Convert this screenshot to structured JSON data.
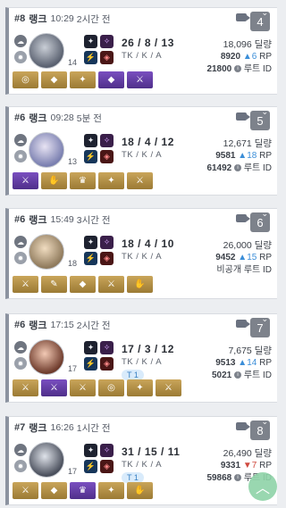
{
  "labels": {
    "mode": "랭크",
    "kda": "TK / K / A",
    "damage_unit": "딜량",
    "rp_unit": "RP",
    "route_id": "루트 ID"
  },
  "matches": [
    {
      "place": "#8",
      "time": "10:29",
      "ago": "2시간 전",
      "badge": "4",
      "level": "14",
      "kda": "26 / 8 / 13",
      "tag": "",
      "damage": "18,096",
      "rp": "8920",
      "rp_change": "6",
      "rp_dir": "up",
      "route": "21800",
      "items": [
        "◎",
        "◆",
        "✦",
        "◆",
        "⚔"
      ]
    },
    {
      "place": "#6",
      "time": "09:28",
      "ago": "5분 전",
      "badge": "5",
      "level": "13",
      "kda": "18 / 4 / 12",
      "tag": "",
      "damage": "12,671",
      "rp": "9581",
      "rp_change": "18",
      "rp_dir": "up",
      "route": "61492",
      "items": [
        "⚔",
        "✋",
        "♛",
        "✦",
        "⚔"
      ]
    },
    {
      "place": "#6",
      "time": "15:49",
      "ago": "3시간 전",
      "badge": "6",
      "level": "18",
      "kda": "18 / 4 / 10",
      "tag": "",
      "damage": "26,000",
      "rp": "9452",
      "rp_change": "15",
      "rp_dir": "up",
      "route": "비공개",
      "items": [
        "⚔",
        "✎",
        "◆",
        "⚔",
        "✋"
      ]
    },
    {
      "place": "#6",
      "time": "17:15",
      "ago": "2시간 전",
      "badge": "7",
      "level": "17",
      "kda": "17 / 3 / 12",
      "tag": "T 1",
      "damage": "7,675",
      "rp": "9513",
      "rp_change": "14",
      "rp_dir": "up",
      "route": "5021",
      "items": [
        "⚔",
        "⚔",
        "⚔",
        "◎",
        "✦",
        "⚔"
      ]
    },
    {
      "place": "#7",
      "time": "16:26",
      "ago": "1시간 전",
      "badge": "8",
      "level": "17",
      "kda": "31 / 15 / 11",
      "tag": "T 1",
      "damage": "26,490",
      "rp": "9331",
      "rp_change": "7",
      "rp_dir": "down",
      "route": "59868",
      "items": [
        "⚔",
        "◆",
        "♛",
        "✦",
        "✋"
      ]
    }
  ],
  "colors": {
    "accent": "#3b8ed8",
    "down": "#d04a3f",
    "fab": "#8fd3a8"
  }
}
